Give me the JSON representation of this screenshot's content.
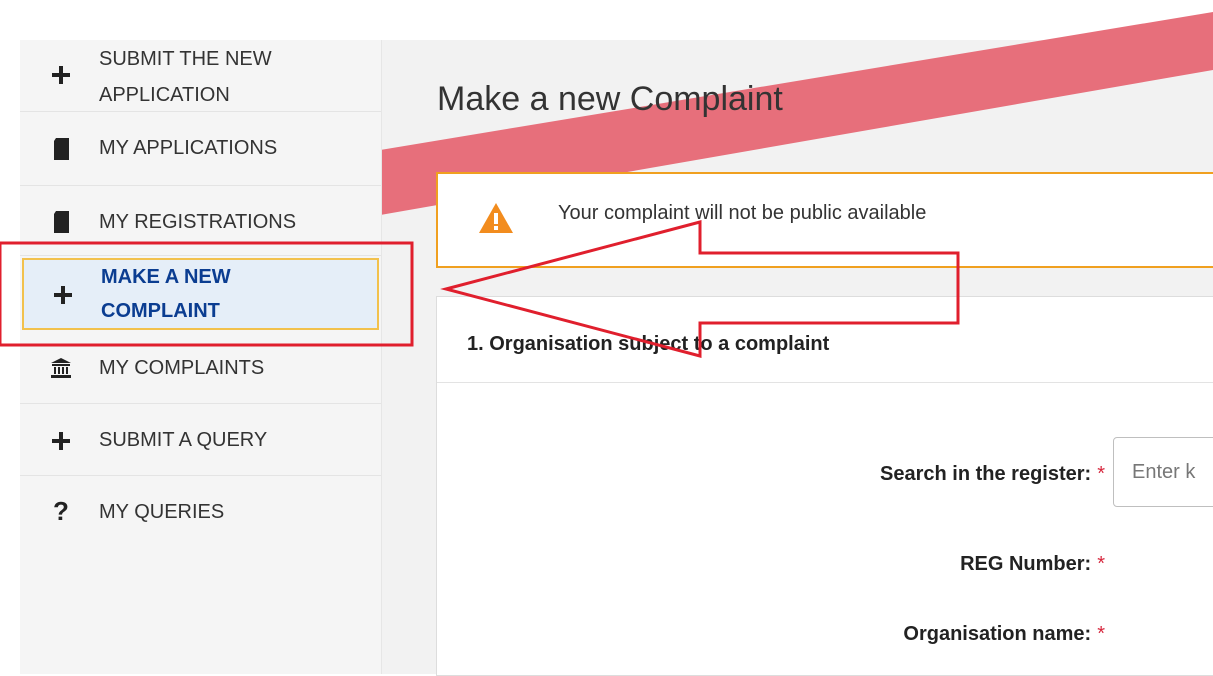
{
  "sidebar": {
    "items": [
      {
        "label_line1": "SUBMIT THE NEW",
        "label_line2": "APPLICATION",
        "icon": "plus-icon"
      },
      {
        "label": "MY APPLICATIONS",
        "icon": "document-icon"
      },
      {
        "label": "MY REGISTRATIONS",
        "icon": "document-icon"
      },
      {
        "label_line1": "MAKE A NEW",
        "label_line2": "COMPLAINT",
        "icon": "plus-icon",
        "active": true
      },
      {
        "label": "MY COMPLAINTS",
        "icon": "institution-icon"
      },
      {
        "label": "SUBMIT A QUERY",
        "icon": "plus-icon"
      },
      {
        "label": "MY QUERIES",
        "icon": "question-icon"
      }
    ]
  },
  "main": {
    "title": "Make a new Complaint",
    "alert": {
      "text": "Your complaint will not be public available",
      "icon": "warning-icon"
    },
    "section": {
      "title": "1. Organisation subject to a complaint",
      "fields": [
        {
          "label": "Search in the register:",
          "required": "*",
          "placeholder": "Enter k"
        },
        {
          "label": "REG Number:",
          "required": "*"
        },
        {
          "label": "Organisation name:",
          "required": "*"
        }
      ]
    }
  },
  "colors": {
    "accent": "#0b3d91",
    "active_border": "#f2c14c",
    "alert_border": "#f0a020",
    "required": "#d7263d",
    "annotation": "#e8424f"
  }
}
